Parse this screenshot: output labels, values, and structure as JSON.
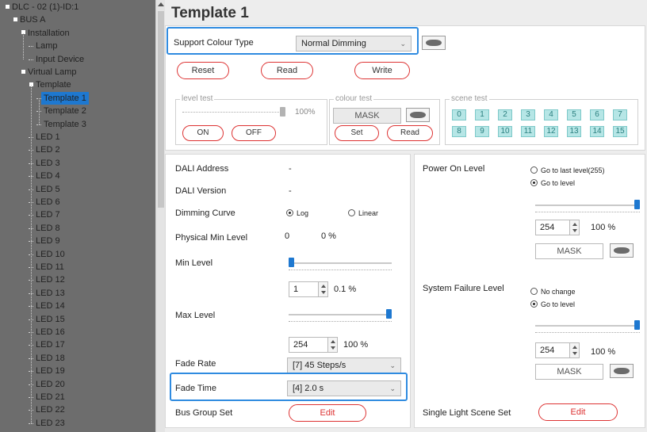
{
  "tree": {
    "nodes": [
      {
        "label": "DLC - 02 (1)-ID:1"
      },
      {
        "label": "BUS A"
      },
      {
        "label": "Installation"
      },
      {
        "label": "Lamp"
      },
      {
        "label": "Input Device"
      },
      {
        "label": "Virtual Lamp"
      },
      {
        "label": "Template"
      },
      {
        "label": "Template 1",
        "selected": true
      },
      {
        "label": "Template 2"
      },
      {
        "label": "Template 3"
      },
      {
        "label": "LED 1"
      },
      {
        "label": "LED 2"
      },
      {
        "label": "LED 3"
      },
      {
        "label": "LED 4"
      },
      {
        "label": "LED 5"
      },
      {
        "label": "LED 6"
      },
      {
        "label": "LED 7"
      },
      {
        "label": "LED 8"
      },
      {
        "label": "LED 9"
      },
      {
        "label": "LED 10"
      },
      {
        "label": "LED 11"
      },
      {
        "label": "LED 12"
      },
      {
        "label": "LED 13"
      },
      {
        "label": "LED 14"
      },
      {
        "label": "LED 15"
      },
      {
        "label": "LED 16"
      },
      {
        "label": "LED 17"
      },
      {
        "label": "LED 18"
      },
      {
        "label": "LED 19"
      },
      {
        "label": "LED 20"
      },
      {
        "label": "LED 21"
      },
      {
        "label": "LED 22"
      },
      {
        "label": "LED 23"
      }
    ]
  },
  "header": {
    "title": "Template 1"
  },
  "colour_type": {
    "label": "Support Colour Type",
    "value": "Normal Dimming"
  },
  "actions": {
    "reset": "Reset",
    "read": "Read",
    "write": "Write"
  },
  "level_test": {
    "title": "level test",
    "percent": "100%",
    "level_fraction": 1.0,
    "on": "ON",
    "off": "OFF"
  },
  "colour_test": {
    "title": "colour test",
    "mask": "MASK",
    "set": "Set",
    "read": "Read"
  },
  "scene_test": {
    "title": "scene test",
    "scenes": [
      "0",
      "1",
      "2",
      "3",
      "4",
      "5",
      "6",
      "7",
      "8",
      "9",
      "10",
      "11",
      "12",
      "13",
      "14",
      "15"
    ]
  },
  "left": {
    "dali_address": {
      "label": "DALI Address",
      "value": "-"
    },
    "dali_version": {
      "label": "DALI Version",
      "value": "-"
    },
    "dimming_curve": {
      "label": "Dimming Curve",
      "log": "Log",
      "linear": "Linear",
      "selected": "Log"
    },
    "physical_min": {
      "label": "Physical Min Level",
      "value": "0",
      "percent": "0 %"
    },
    "min_level": {
      "label": "Min Level",
      "value": "1",
      "percent": "0.1 %",
      "level_fraction": 0.0
    },
    "max_level": {
      "label": "Max Level",
      "value": "254",
      "percent": "100 %",
      "level_fraction": 1.0
    },
    "fade_rate": {
      "label": "Fade Rate",
      "value": "[7] 45 Steps/s"
    },
    "fade_time": {
      "label": "Fade Time",
      "value": "[4] 2.0 s"
    },
    "bus_group": {
      "label": "Bus Group Set",
      "button": "Edit"
    }
  },
  "right": {
    "power_on": {
      "label": "Power On Level",
      "opt1": "Go to last level(255)",
      "opt2": "Go to level",
      "selected": "Go to level",
      "value": "254",
      "percent": "100 %",
      "mask": "MASK",
      "level_fraction": 1.0
    },
    "system_failure": {
      "label": "System Failure Level",
      "opt1": "No change",
      "opt2": "Go to level",
      "selected": "Go to level",
      "value": "254",
      "percent": "100 %",
      "mask": "MASK",
      "level_fraction": 1.0
    },
    "single_scene": {
      "label": "Single Light Scene Set",
      "button": "Edit"
    }
  },
  "colors": {
    "accent": "#1e78d0",
    "highlight": "#2f8be0",
    "button_border": "#dd3333",
    "scene_fill": "#b6e6e6"
  }
}
